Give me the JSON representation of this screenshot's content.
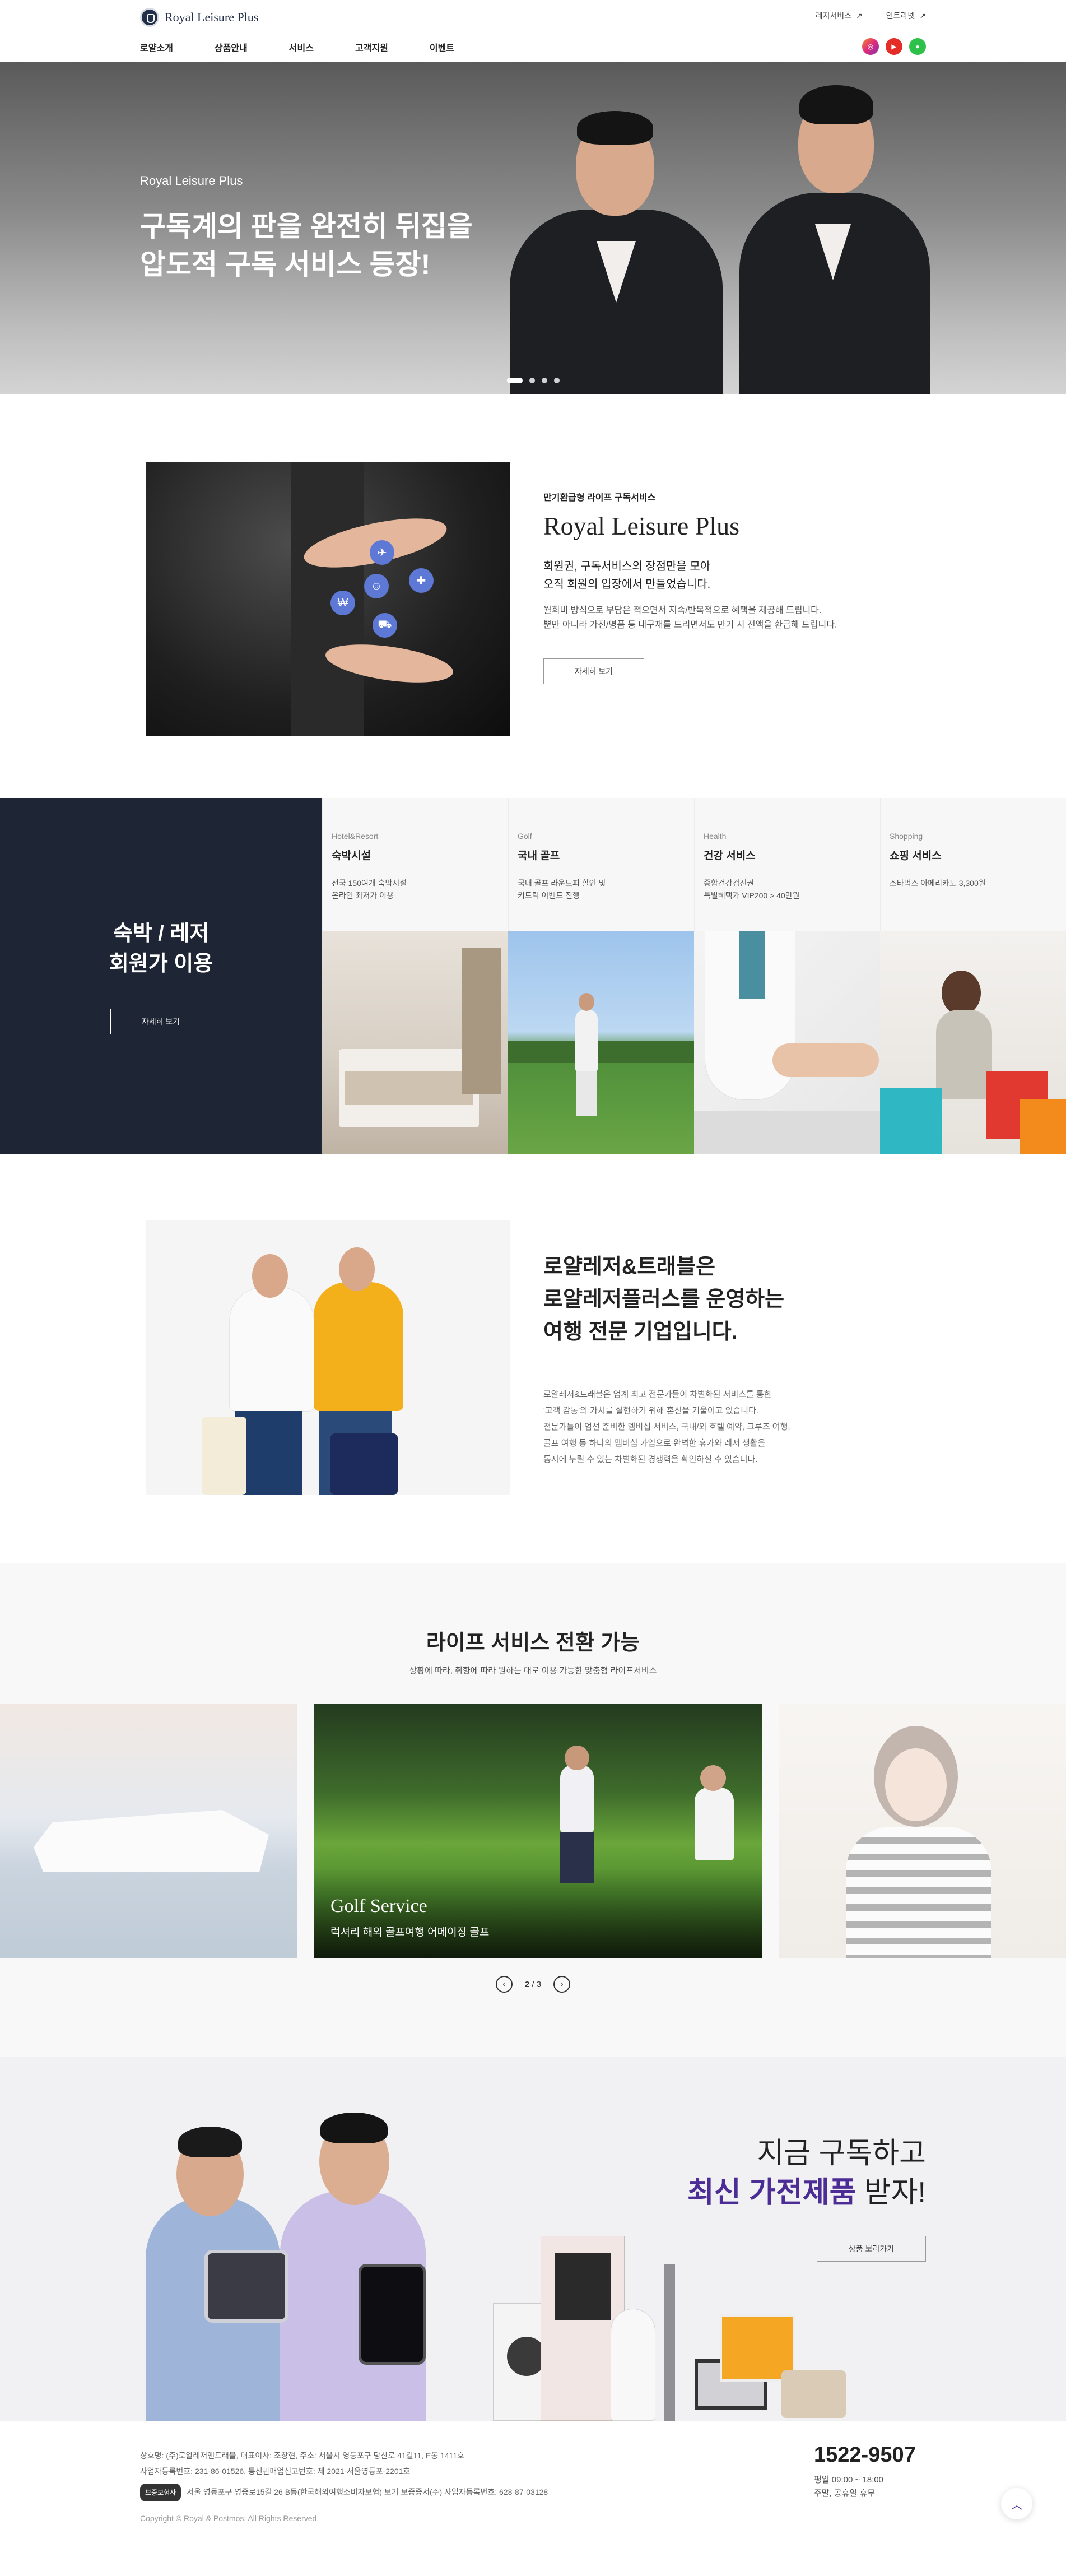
{
  "header": {
    "logo_text": "Royal Leisure Plus",
    "util_links": [
      {
        "label": "레저서비스",
        "arrow": "↗"
      },
      {
        "label": "인트라넷",
        "arrow": "↗"
      }
    ],
    "nav": [
      "로얄소개",
      "상품안내",
      "서비스",
      "고객지원",
      "이벤트"
    ],
    "sns": [
      "instagram-icon",
      "youtube-icon",
      "line-icon"
    ]
  },
  "hero": {
    "subtitle": "Royal Leisure Plus",
    "title_line1": "구독계의 판을 완전히 뒤집을",
    "title_line2": "압도적 구독 서비스 등장!"
  },
  "intro": {
    "kicker": "만기환급형 라이프 구독서비스",
    "brand": "Royal Leisure Plus",
    "lead_line1": "회원권, 구독서비스의 장점만을 모아",
    "lead_line2": "오직 회원의 입장에서 만들었습니다.",
    "desc_line1": "월회비 방식으로 부담은 적으면서 지속/반복적으로 혜택을 제공해 드립니다.",
    "desc_line2": "뿐만 아니라 가전/명품 등 내구재를 드리면서도 만기 시 전액을 환급해 드립니다.",
    "button": "자세히 보기"
  },
  "services": {
    "title_line1": "숙박 / 레저",
    "title_line2": "회원가 이용",
    "button": "자세히 보기",
    "items": [
      {
        "category": "Hotel&Resort",
        "name": "숙박시설",
        "detail": "전국 150여개 숙박시설\n온라인 최저가 이용"
      },
      {
        "category": "Golf",
        "name": "국내 골프",
        "detail": "국내 골프 라운드피 할인 및\n키트릭 이벤트 진행"
      },
      {
        "category": "Health",
        "name": "건강 서비스",
        "detail": "종합건강검진권\n특별혜택가 VIP200 > 40만원"
      },
      {
        "category": "Shopping",
        "name": "쇼핑 서비스",
        "detail": "스타벅스 아메리카노 3,300원"
      }
    ]
  },
  "about": {
    "title_line1": "로얄레저&트래블은",
    "title_line2": "로얄레저플러스를 운영하는",
    "title_line3": "여행 전문 기업입니다.",
    "body_line1": "로얄레저&트래블은 업계 최고 전문가들이 차별화된 서비스를 통한",
    "body_line2": "'고객 감동'의 가치를 실현하기 위해 혼신을 기울이고 있습니다.",
    "body_line3": "전문가들이 엄선 준비한 멤버십 서비스, 국내/외 호텔 예약, 크루즈 여행,",
    "body_line4": "골프 여행 등 하나의 멤버십 가입으로 완벽한 휴가와 레저 생활을",
    "body_line5": "동시에 누릴 수 있는 차별화된 경쟁력을 확인하실 수 있습니다."
  },
  "life": {
    "title": "라이프 서비스 전환 가능",
    "subtitle": "상황에 따라, 취향에 따라 원하는 대로 이용 가능한 맞춤형 라이프서비스",
    "active_slide": {
      "title": "Golf Service",
      "desc": "럭셔리 해외 골프여행 어메이징 골프"
    },
    "pager_current": "2",
    "pager_sep": "/",
    "pager_total": "3"
  },
  "cta": {
    "line1": "지금 구독하고",
    "line2_highlight": "최신 가전제품",
    "line2_rest": " 받자!",
    "button": "상품 보러가기"
  },
  "footer": {
    "line1": "상호명: (주)로얄레저앤트래블, 대표이사: 조창현, 주소: 서울시 영등포구 당산로 41길11, E동 1411호",
    "line2": "사업자등록번호: 231-86-01526, 통신판매업신고번호: 제 2021-서울영등포-2201호",
    "tag": "보증보험사",
    "line3": "서울 영등포구 영중로15길 26 B동(한국해외여행소비자보험) 보기 보증증서(주) 사업자등록번호: 628-87-03128",
    "copyright": "Copyright © Royal & Postmos. All Rights Reserved.",
    "phone": "1522-9507",
    "hours_line1": "평일 09:00 ~ 18:00",
    "hours_line2": "주말, 공휴일 휴무"
  },
  "colors": {
    "navy": "#1e2534",
    "accent": "#4b2d95"
  }
}
